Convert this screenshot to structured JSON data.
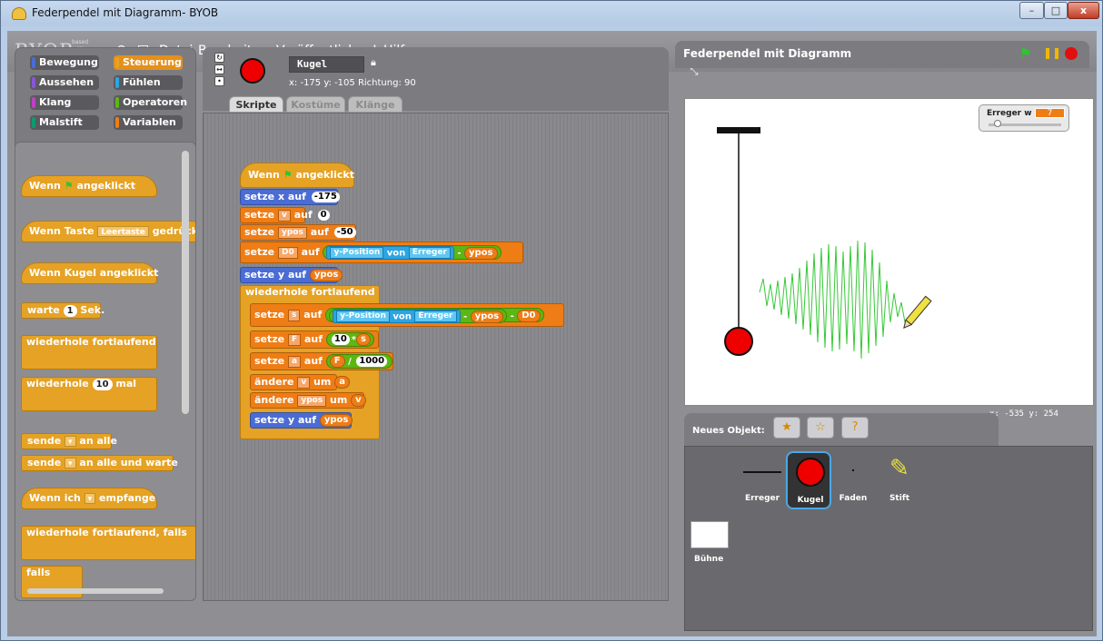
{
  "window": {
    "title": "Federpendel mit Diagramm- BYOB",
    "min": "–",
    "max": "□",
    "close": "x"
  },
  "menubar": {
    "logo": "BYOB",
    "logo_sub": "based on SCRATCH by MIT",
    "menus": [
      "Datei",
      "Bearbeiten",
      "Veröffentlichen!",
      "Hilfe"
    ]
  },
  "categories": [
    {
      "label": "Bewegung",
      "color": "#4a6cd4"
    },
    {
      "label": "Steuerung",
      "color": "#e5a224",
      "selected": true
    },
    {
      "label": "Aussehen",
      "color": "#8a55d7"
    },
    {
      "label": "Fühlen",
      "color": "#2ca5e2"
    },
    {
      "label": "Klang",
      "color": "#bb42c3"
    },
    {
      "label": "Operatoren",
      "color": "#5cb712"
    },
    {
      "label": "Malstift",
      "color": "#0e9a6c"
    },
    {
      "label": "Variablen",
      "color": "#ee7d16"
    }
  ],
  "palette": {
    "wenn_flag": "Wenn",
    "wenn_flag_2": "angeklickt",
    "wenn_taste": "Wenn Taste",
    "leertaste": "Leertaste",
    "gedrueckt": "gedrückt",
    "wenn_kugel": "Wenn Kugel angeklickt",
    "warte": "warte",
    "warte_val": "1",
    "sek": "Sek.",
    "wiederhole_fortlaufend": "wiederhole fortlaufend",
    "wiederhole": "wiederhole",
    "wiederhole_val": "10",
    "mal": "mal",
    "sende": "sende",
    "an_alle": "an alle",
    "an_alle_und_warte": "an alle und warte",
    "wenn_ich": "Wenn ich",
    "empfange": "empfange",
    "wiederhole_falls": "wiederhole fortlaufend, falls",
    "falls": "falls",
    "falls2": "falls"
  },
  "sprite": {
    "name": "Kugel",
    "info": "x: -175 y: -105 Richtung: 90",
    "tabs": [
      "Skripte",
      "Kostüme",
      "Klänge"
    ]
  },
  "script": {
    "hat": "Wenn",
    "hat2": "angeklickt",
    "l1": "setze x auf",
    "l1v": "-175",
    "l2a": "setze",
    "l2var": "v",
    "l2b": "auf",
    "l2v": "0",
    "l3a": "setze",
    "l3var": "ypos",
    "l3b": "auf",
    "l3v": "-50",
    "l4a": "setze",
    "l4var": "D0",
    "l4b": "auf",
    "l4s1": "y-Position",
    "l4s2": "von",
    "l4s3": "Erreger",
    "l4m": "-",
    "l4r": "ypos",
    "l5": "setze y auf",
    "l5r": "ypos",
    "loop": "wiederhole fortlaufend",
    "l6a": "setze",
    "l6var": "s",
    "l6b": "auf",
    "l6s1": "y-Position",
    "l6s2": "von",
    "l6s3": "Erreger",
    "l6m": "-",
    "l6r": "ypos",
    "l6m2": "-",
    "l6r2": "D0",
    "l7a": "setze",
    "l7var": "F",
    "l7b": "auf",
    "l7n": "10",
    "l7op": "*",
    "l7r": "s",
    "l8a": "setze",
    "l8var": "a",
    "l8b": "auf",
    "l8l": "F",
    "l8op": "/",
    "l8n": "1000",
    "l9a": "ändere",
    "l9var": "v",
    "l9b": "um",
    "l9r": "a",
    "l10a": "ändere",
    "l10var": "ypos",
    "l10b": "um",
    "l10r": "v",
    "l11": "setze y auf",
    "l11r": "ypos"
  },
  "stage": {
    "title": "Federpendel mit Diagramm",
    "coords": "x: -535  y: 254",
    "monitor_label": "Erreger w",
    "monitor_value": "7"
  },
  "new_sprite": {
    "label": "Neues Objekt:"
  },
  "sprites": [
    {
      "name": "Erreger"
    },
    {
      "name": "Kugel",
      "selected": true
    },
    {
      "name": "Faden"
    },
    {
      "name": "Stift"
    }
  ],
  "buehne": "Bühne"
}
